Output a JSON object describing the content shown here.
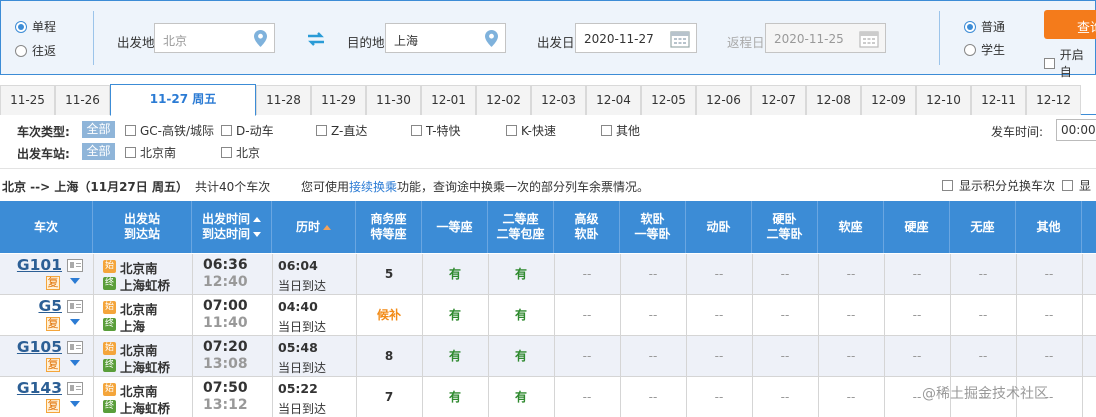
{
  "search": {
    "trip_types": [
      "单程",
      "往返"
    ],
    "from_label": "出发地",
    "from_value": "北京",
    "to_label": "目的地",
    "to_value": "上海",
    "depart_label": "出发日",
    "depart_value": "2020-11-27",
    "return_label": "返程日",
    "return_value": "2020-11-25",
    "ticket_types": [
      "普通",
      "学生"
    ],
    "query_button": "查询",
    "auto_label": "开启自"
  },
  "date_tabs": [
    "11-25",
    "11-26",
    "11-27 周五",
    "11-28",
    "11-29",
    "11-30",
    "12-01",
    "12-02",
    "12-03",
    "12-04",
    "12-05",
    "12-06",
    "12-07",
    "12-08",
    "12-09",
    "12-10",
    "12-11",
    "12-12"
  ],
  "filters": {
    "type_title": "车次类型:",
    "station_title": "出发车站:",
    "all_label": "全部",
    "types": [
      "GC-高铁/城际",
      "D-动车",
      "Z-直达",
      "T-特快",
      "K-快速",
      "其他"
    ],
    "stations": [
      "北京南",
      "北京"
    ],
    "depart_time_label": "发车时间:",
    "depart_time_value": "00:00-"
  },
  "summary": {
    "route": "北京 --> 上海（11月27日  周五）",
    "count": "共计40个车次",
    "hint_pre": "您可使用",
    "hint_link": "接续换乘",
    "hint_post": "功能，查询途中换乘一次的部分列车余票情况。",
    "opt1": "显示积分兑换车次",
    "opt2": "显"
  },
  "table": {
    "headers": {
      "train": "车次",
      "station_1": "出发站",
      "station_2": "到达站",
      "time_1": "出发时间",
      "time_2": "到达时间",
      "duration": "历时",
      "business_1": "商务座",
      "business_2": "特等座",
      "first": "一等座",
      "second_1": "二等座",
      "second_2": "二等包座",
      "advsoft_1": "高级",
      "advsoft_2": "软卧",
      "soft_1": "软卧",
      "soft_2": "一等卧",
      "moving": "动卧",
      "hard_1": "硬卧",
      "hard_2": "二等卧",
      "softseat": "软座",
      "hardseat": "硬座",
      "noseat": "无座",
      "other": "其他"
    },
    "fu": "复",
    "start_badge": "始",
    "end_badge": "终",
    "rows": [
      {
        "train": "G101",
        "from": "北京南",
        "to": "上海虹桥",
        "dep": "06:36",
        "arr": "12:40",
        "dur": "06:04",
        "day": "当日到达",
        "seats": [
          "5",
          "有",
          "有",
          "--",
          "--",
          "--",
          "--",
          "--",
          "--",
          "--",
          "--"
        ]
      },
      {
        "train": "G5",
        "from": "北京南",
        "to": "上海",
        "dep": "07:00",
        "arr": "11:40",
        "dur": "04:40",
        "day": "当日到达",
        "seats": [
          "候补",
          "有",
          "有",
          "--",
          "--",
          "--",
          "--",
          "--",
          "--",
          "--",
          "--"
        ]
      },
      {
        "train": "G105",
        "from": "北京南",
        "to": "上海虹桥",
        "dep": "07:20",
        "arr": "13:08",
        "dur": "05:48",
        "day": "当日到达",
        "seats": [
          "8",
          "有",
          "有",
          "--",
          "--",
          "--",
          "--",
          "--",
          "--",
          "--",
          "--"
        ]
      },
      {
        "train": "G143",
        "from": "北京南",
        "to": "上海虹桥",
        "dep": "07:50",
        "arr": "13:12",
        "dur": "05:22",
        "day": "当日到达",
        "seats": [
          "7",
          "有",
          "有",
          "--",
          "--",
          "--",
          "--",
          "--",
          "--",
          "--",
          "--"
        ]
      }
    ]
  },
  "watermark": "@稀土掘金技术社区",
  "colors": {
    "accent": "#3c8cd6",
    "query": "#f47b1b",
    "yes": "#2f8a2f",
    "waitlist": "#f28b17"
  }
}
